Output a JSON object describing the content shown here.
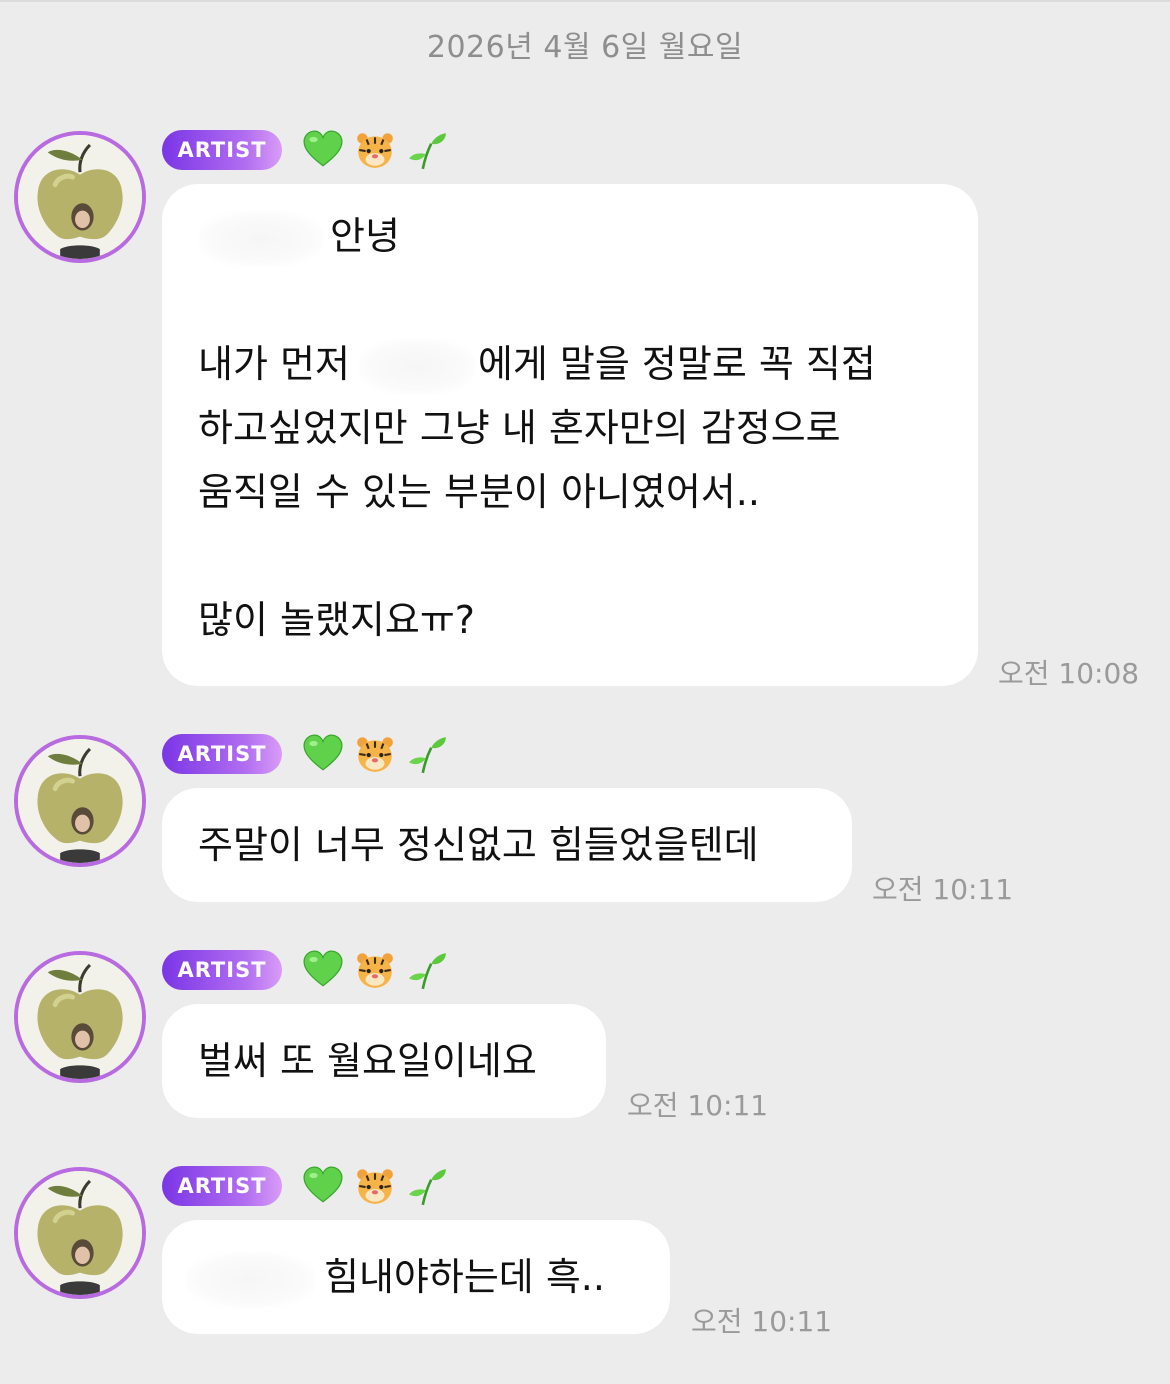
{
  "date_header": "2026년 4월 6일 월요일",
  "badge_label": "ARTIST",
  "emoji_names": [
    "green-heart-icon",
    "tiger-face-icon",
    "seedling-icon"
  ],
  "messages": [
    {
      "lines": [
        "안녕",
        "",
        "내가 먼저",
        "에게 말을 정말로 꼭 직접",
        "하고싶었지만 그냥 내 혼자만의 감정으로",
        "움직일 수 있는 부분이 아니였어서..",
        "",
        "많이 놀랬지요ㅠ?"
      ],
      "time": "오전 10:08"
    },
    {
      "lines": [
        "주말이 너무 정신없고 힘들었을텐데"
      ],
      "time": "오전 10:11"
    },
    {
      "lines": [
        "벌써 또 월요일이네요"
      ],
      "time": "오전 10:11"
    },
    {
      "lines": [
        "힘내야하는데 흑.."
      ],
      "time": "오전 10:11"
    }
  ]
}
